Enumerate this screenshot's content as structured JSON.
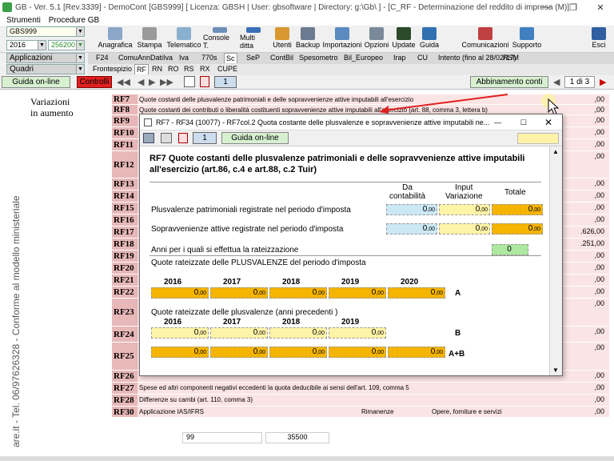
{
  "window": {
    "title": "GB - Ver. 5.1 [Rev.3339] - DemoCont [GBS999]    [ Licenza: GBSH | User: gbsoftware | Directory: g:\\Gb\\ ] - [C_RF - Determinazione del reddito di impresa (M)]",
    "min": "—",
    "max": "❐",
    "close": "✕"
  },
  "menu": [
    "Strumenti",
    "Procedure GB"
  ],
  "selectors": {
    "company": "GBS999",
    "year": "2016",
    "code": "256200 -",
    "applications": "Applicazioni",
    "frames": "Quadri"
  },
  "toolbar": [
    {
      "label": "Anagrafica",
      "color": "#8aa6c8"
    },
    {
      "label": "Stampa",
      "color": "#9a9a9a"
    },
    {
      "label": "Telematico",
      "color": "#8ab0d0"
    },
    {
      "label": "Console T.",
      "color": "#6d8fb8"
    },
    {
      "label": "Multi ditta",
      "color": "#3a6fb8"
    },
    {
      "label": "Utenti",
      "color": "#d89830"
    },
    {
      "label": "Backup",
      "color": "#6a7a90"
    },
    {
      "label": "Importazioni",
      "color": "#5a8ac0"
    },
    {
      "label": "Opzioni",
      "color": "#7a8a9a"
    },
    {
      "label": "Update",
      "color": "#2a4a2a"
    },
    {
      "label": "Guida",
      "color": "#3070b0"
    },
    {
      "label": "Comunicazioni",
      "color": "#c04040"
    },
    {
      "label": "Supporto",
      "color": "#4080c0"
    },
    {
      "label": "Esci",
      "color": "#3060a0"
    }
  ],
  "nav_tabs": [
    "F24",
    "ComuAnnDatiIva",
    "Iva",
    "770s",
    "Sc",
    "SeP",
    "ContBil",
    "Spesometro",
    "Bil_Europeo",
    "Irap",
    "CU",
    "Intento (fino al 28/02/17)",
    "RSM"
  ],
  "sub_tabs": [
    "Frontespizio",
    "RF",
    "RN",
    "RO",
    "RS",
    "RX",
    "CUPE"
  ],
  "bar": {
    "guide": "Guida on-line",
    "controls": "Controlli",
    "page": "1",
    "match": "Abbinamento conti",
    "pager": "1 di 3"
  },
  "side_title": "Variazioni\nin aumento",
  "vertical_text": "are.it - Tel. 06/97626328 - Conforme al modello ministeriale",
  "rows": [
    {
      "code": "RF7",
      "text": "Quote costanti delle plusvalenze patrimoniali e delle sopravvenienze attive imputabili all'esercizio",
      "val": ",00"
    },
    {
      "code": "RF8",
      "text": "Quote costanti dei contributi o liberalità costituenti sopravvenienze attive imputabili all'esercizio (art. 88, comma 3, lettera b)",
      "val": ",00"
    },
    {
      "code": "RF9",
      "text": "",
      "val": ",00"
    },
    {
      "code": "RF10",
      "text": "",
      "val": ",00"
    },
    {
      "code": "RF11",
      "text": "",
      "val": ",00"
    },
    {
      "code": "RF12",
      "text": "",
      "val": ",00"
    },
    {
      "code": "RF13",
      "text": "",
      "val": ",00"
    },
    {
      "code": "RF14",
      "text": "",
      "val": ",00"
    },
    {
      "code": "RF15",
      "text": "",
      "val": ",00"
    },
    {
      "code": "RF16",
      "text": "",
      "val": ",00"
    },
    {
      "code": "RF17",
      "text": "",
      "val": ".626,00"
    },
    {
      "code": "RF18",
      "text": "",
      "val": ".251,00"
    },
    {
      "code": "RF19",
      "text": "",
      "val": ",00"
    },
    {
      "code": "RF20",
      "text": "",
      "val": ",00"
    },
    {
      "code": "RF21",
      "text": "",
      "val": ",00"
    },
    {
      "code": "RF22",
      "text": "",
      "val": ",00"
    },
    {
      "code": "RF23",
      "text": "",
      "val": ",00"
    },
    {
      "code": "RF24",
      "text": "",
      "val": ",00"
    },
    {
      "code": "RF25",
      "text": "",
      "val": ",00"
    },
    {
      "code": "RF26",
      "text": "",
      "val": ",00"
    },
    {
      "code": "RF27",
      "text": "Spese ed altri componenti negativi eccedenti la quota deducibile ai sensi dell'art. 109, comma 5",
      "val": ",00"
    },
    {
      "code": "RF28",
      "text": "Differenze su cambi (art. 110, comma 3)",
      "val": ",00"
    },
    {
      "code": "RF30",
      "text": "Applicazione IAS/IFRS",
      "val": ",00"
    }
  ],
  "rf30": {
    "col1": "Rimanenze",
    "col2": "Opere, forniture e servizi",
    "v1": "99",
    "v2": "35500",
    "zero": ",00"
  },
  "dialog": {
    "title": "RF7 - RF34 (10077) - RF7col.2 Quota costante delle plusvalenze e sopravvenienze attive imputabili ne...",
    "page": "1",
    "guide": "Guida on-line",
    "heading": "RF7 Quote costanti delle plusvalenze patrimoniali e delle sopravvenienze attive imputabili all'esercizio (art.86, c.4 e art.88, c.2 Tuir)",
    "col_da": "Da\ncontabilità",
    "col_input": "Input\nVariazione",
    "col_totale": "Totale",
    "row_plus": "Plusvalenze patrimoniali registrate nel periodo d'imposta",
    "row_sopr": "Sopravvenienze attive registrate nel periodo d'imposta",
    "row_anni": "Anni per i quali si effettua la rateizzazione",
    "anni_val": "0",
    "sec_a": "Quote rateizzate delle PLUSVALENZE del periodo d'imposta",
    "sec_b": "Quote rateizzate delle plusvalenze  (anni precedenti )",
    "years_a": [
      "2016",
      "2017",
      "2018",
      "2019",
      "2020"
    ],
    "years_b": [
      "2016",
      "2017",
      "2018",
      "2019"
    ],
    "lbl_a": "A",
    "lbl_b": "B",
    "lbl_ab": "A+B",
    "zero": "0",
    "dec": ",00"
  }
}
